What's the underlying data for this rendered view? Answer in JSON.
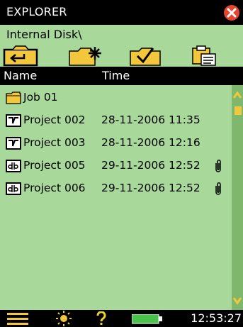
{
  "window": {
    "title": "EXPLORER",
    "icons": {
      "close": "close-icon"
    }
  },
  "path": "Internal Disk\\",
  "toolbar": {
    "icons": [
      "folder-up-icon",
      "new-folder-icon",
      "select-folder-icon",
      "clipboard-paste-icon"
    ]
  },
  "columns": {
    "name": "Name",
    "time": "Time"
  },
  "rows": [
    {
      "type": "folder",
      "icon": "folder-icon",
      "name": "Job 01",
      "time": "",
      "attachment": false
    },
    {
      "type": "project",
      "icon": "waveform-file-icon",
      "name": "Project 002",
      "time": "28-11-2006 11:35",
      "attachment": false
    },
    {
      "type": "project",
      "icon": "waveform-file-icon",
      "name": "Project 003",
      "time": "28-11-2006 12:16",
      "attachment": false
    },
    {
      "type": "db",
      "icon": "db-file-icon",
      "name": "Project 005",
      "time": "29-11-2006 12:52",
      "attachment": true
    },
    {
      "type": "db",
      "icon": "db-file-icon",
      "name": "Project 006",
      "time": "29-11-2006 12:52",
      "attachment": true
    }
  ],
  "statusbar": {
    "icons": [
      "menu-icon",
      "brightness-icon",
      "help-icon",
      "battery-icon"
    ],
    "clock": "12:53:27"
  },
  "colors": {
    "background": "#a9d99a",
    "bars": "#000000",
    "close": "#e6462f",
    "folder": "#f3c73b",
    "battery": "#4ac24a",
    "help": "#f1d41d"
  }
}
